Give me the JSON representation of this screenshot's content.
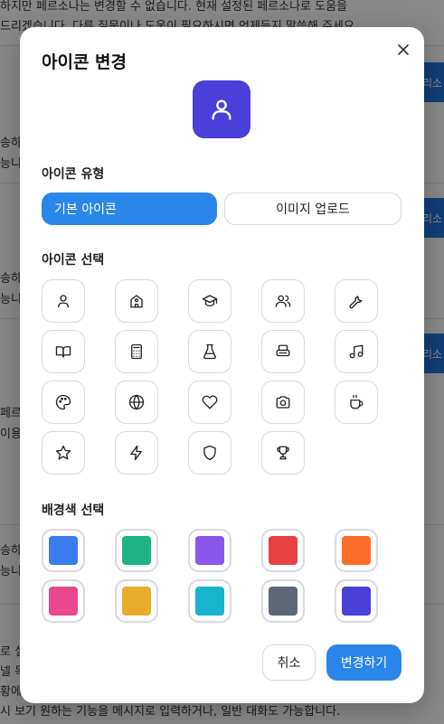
{
  "background": {
    "lines": [
      "하지만 페르소나는 변경할 수 없습니다. 현재 설정된 페르소나로 도움을",
      "드리겠습니다. 다른 질문이나 도움이 필요하시면 언제든지 말씀해 주세요.",
      "송하지",
      "능니다",
      "송하지",
      "능니다",
      "페르소",
      "이용",
      "송하지",
      "능니다",
      "로 설",
      "넬 목",
      "황에",
      "시 보기 원하는 기능을 메시지로 입력하거나, 일반 대화도 가능합니다."
    ],
    "tag_label": "리소"
  },
  "modal": {
    "title": "아이콘 변경",
    "preview_icon": "user-icon",
    "preview_color": "#4a3fd9",
    "icon_type": {
      "label": "아이콘 유형",
      "options": [
        {
          "label": "기본 아이콘",
          "active": true
        },
        {
          "label": "이미지 업로드",
          "active": false
        }
      ]
    },
    "icon_select": {
      "label": "아이콘 선택",
      "icons": [
        "user-icon",
        "school-icon",
        "graduation-cap-icon",
        "users-icon",
        "wrench-icon",
        "book-open-icon",
        "calculator-icon",
        "flask-icon",
        "printer-icon",
        "music-icon",
        "palette-icon",
        "globe-icon",
        "heart-icon",
        "camera-icon",
        "coffee-icon",
        "star-icon",
        "zap-icon",
        "shield-icon",
        "trophy-icon"
      ]
    },
    "bg_color": {
      "label": "배경색 선택",
      "colors": [
        "#3b7ced",
        "#1db385",
        "#8a57ea",
        "#e84141",
        "#fb6c26",
        "#e9488e",
        "#e8ac2a",
        "#17b3cf",
        "#5e6776",
        "#4a3fd9"
      ]
    },
    "buttons": {
      "cancel": "취소",
      "confirm": "변경하기"
    }
  }
}
